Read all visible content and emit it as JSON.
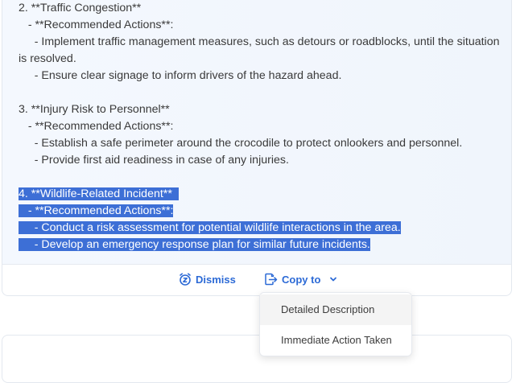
{
  "content": {
    "lines": [
      {
        "text": "2. **Traffic Congestion**",
        "selected": false
      },
      {
        "text": "   - **Recommended Actions**:",
        "selected": false
      },
      {
        "text": "     - Implement traffic management measures, such as detours or roadblocks, until the situation",
        "selected": false
      },
      {
        "text": "is resolved.",
        "selected": false
      },
      {
        "text": "     - Ensure clear signage to inform drivers of the hazard ahead.",
        "selected": false
      },
      {
        "text": "",
        "selected": false
      },
      {
        "text": "3. **Injury Risk to Personnel**",
        "selected": false
      },
      {
        "text": "   - **Recommended Actions**:",
        "selected": false
      },
      {
        "text": "     - Establish a safe perimeter around the crocodile to protect onlookers and personnel.",
        "selected": false
      },
      {
        "text": "     - Provide first aid readiness in case of any injuries.",
        "selected": false
      },
      {
        "text": "",
        "selected": false
      },
      {
        "text": "4. **Wildlife-Related Incident**  ",
        "selected": true
      },
      {
        "text": "   - **Recommended Actions**:",
        "selected": true
      },
      {
        "text": "     - Conduct a risk assessment for potential wildlife interactions in the area.",
        "selected": true
      },
      {
        "text": "     - Develop an emergency response plan for similar future incidents.",
        "selected": true
      }
    ]
  },
  "actions": {
    "dismiss_label": "Dismiss",
    "copy_label": "Copy to",
    "accent_color": "#2c6ad6"
  },
  "dropdown": {
    "items": [
      "Detailed Description",
      "Immediate Action Taken"
    ]
  },
  "colors": {
    "selection": "#3d6fd6",
    "text": "#3a3a3a"
  }
}
